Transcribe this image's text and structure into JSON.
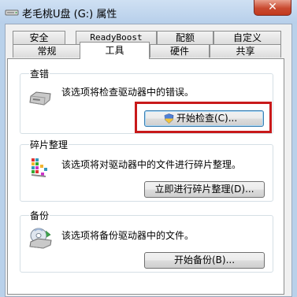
{
  "window": {
    "title": "老毛桃U盘 (G:) 属性",
    "close_label": "✕"
  },
  "tabs_row1": [
    {
      "label": "安全"
    },
    {
      "label": "ReadyBoost"
    },
    {
      "label": "配额"
    },
    {
      "label": "自定义"
    }
  ],
  "tabs_row2": [
    {
      "label": "常规"
    },
    {
      "label": "工具",
      "active": true
    },
    {
      "label": "硬件"
    },
    {
      "label": "共享"
    }
  ],
  "error_check": {
    "title": "查错",
    "description": "该选项将检查驱动器中的错误。",
    "button_label": "开始检查(C)..."
  },
  "defrag": {
    "title": "碎片整理",
    "description": "该选项将对驱动器中的文件进行碎片整理。",
    "button_label": "立即进行碎片整理(D)..."
  },
  "backup": {
    "title": "备份",
    "description": "该选项将备份驱动器中的文件。",
    "button_label": "开始备份(B)..."
  },
  "colors": {
    "highlight": "#c8191a",
    "accent": "#3c7fb1"
  }
}
